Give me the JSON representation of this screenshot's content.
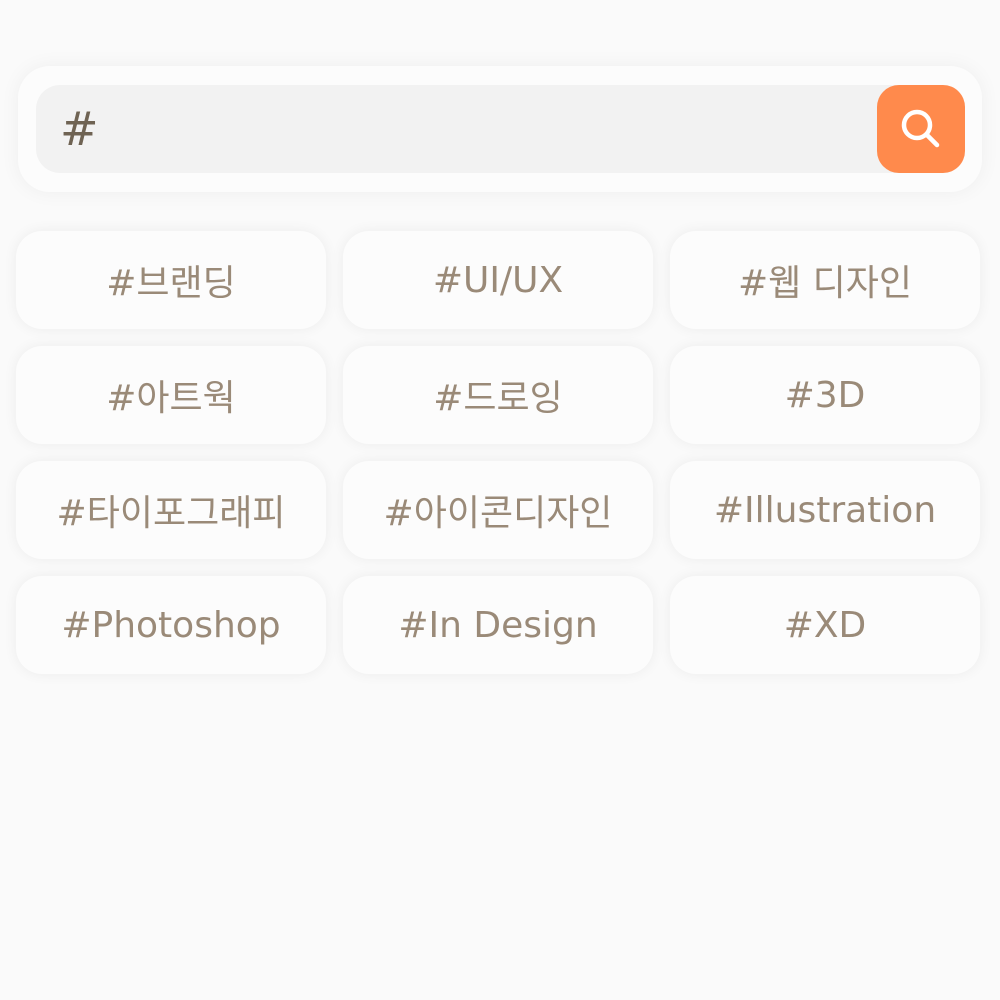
{
  "search": {
    "value": "#",
    "button_icon": "search-icon",
    "accent_color": "#ff8a4c"
  },
  "tags": [
    "#브랜딩",
    "#UI/UX",
    "#웹 디자인",
    "#아트웍",
    "#드로잉",
    "#3D",
    "#타이포그래피",
    "#아이콘디자인",
    "#Illustration",
    "#Photoshop",
    "#In Design",
    "#XD"
  ],
  "colors": {
    "tag_text": "#9a8a78",
    "input_text": "#6f6353",
    "background": "#fafafa"
  }
}
